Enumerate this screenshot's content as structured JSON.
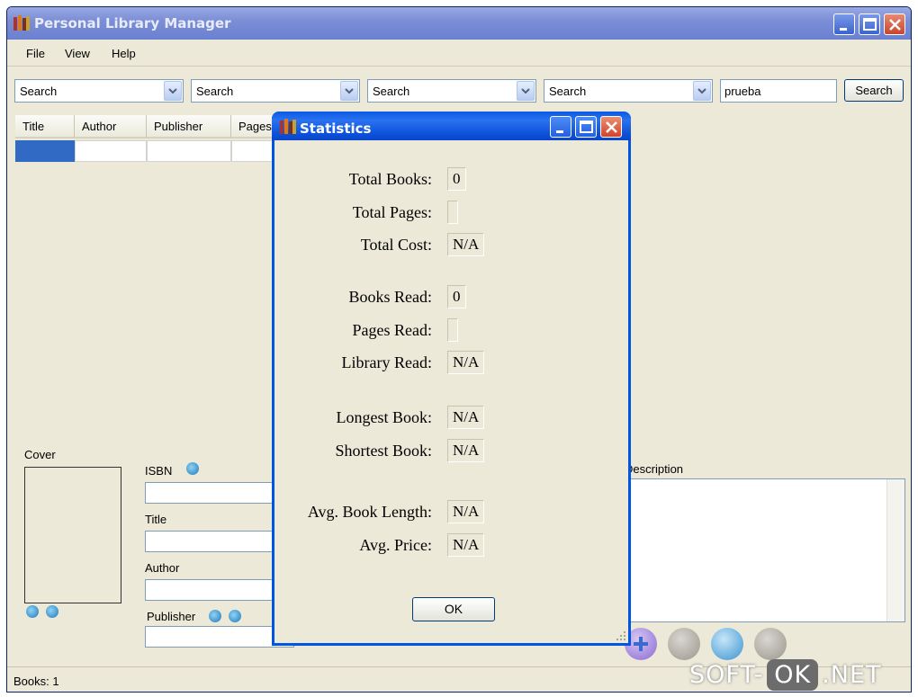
{
  "window": {
    "title": "Personal Library Manager"
  },
  "menu": {
    "file": "File",
    "view": "View",
    "help": "Help"
  },
  "search": {
    "combo1": "Search",
    "combo2": "Search",
    "combo3": "Search",
    "combo4": "Search",
    "query": "prueba",
    "button": "Search"
  },
  "grid": {
    "columns": [
      "Title",
      "Author",
      "Publisher",
      "Pages"
    ]
  },
  "details": {
    "cover_label": "Cover",
    "isbn_label": "ISBN",
    "title_label": "Title",
    "author_label": "Author",
    "publisher_label": "Publisher",
    "description_label": "Description"
  },
  "statusbar": {
    "text": "Books: 1"
  },
  "dialog": {
    "title": "Statistics",
    "rows": [
      {
        "label": "Total Books:",
        "value": "0"
      },
      {
        "label": "Total Pages:",
        "value": ""
      },
      {
        "label": "Total Cost:",
        "value": "N/A"
      },
      {
        "label": "Books Read:",
        "value": "0"
      },
      {
        "label": "Pages Read:",
        "value": ""
      },
      {
        "label": "Library Read:",
        "value": "N/A"
      },
      {
        "label": "Longest Book:",
        "value": "N/A"
      },
      {
        "label": "Shortest Book:",
        "value": "N/A"
      },
      {
        "label": "Avg. Book Length:",
        "value": "N/A"
      },
      {
        "label": "Avg. Price:",
        "value": "N/A"
      }
    ],
    "ok": "OK"
  },
  "watermark": {
    "left": "SOFT-",
    "mid": "OK",
    "right": ".NET"
  },
  "colors": {
    "xp_blue": "#0055e5",
    "selection": "#316ac5"
  }
}
